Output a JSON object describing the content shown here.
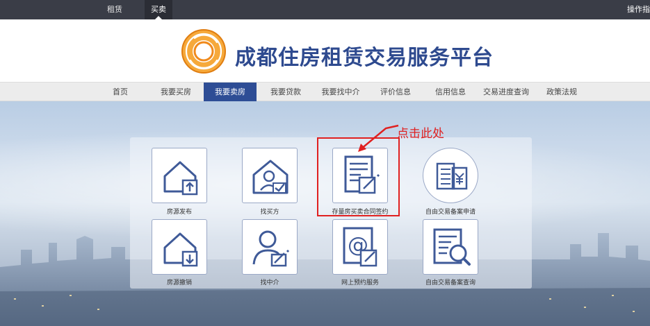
{
  "topbar": {
    "tabs": [
      {
        "label": "租赁"
      },
      {
        "label": "买卖"
      }
    ],
    "guide_label": "操作指"
  },
  "header": {
    "title": "成都住房租赁交易服务平台"
  },
  "nav": {
    "items": [
      {
        "label": "首页"
      },
      {
        "label": "我要买房"
      },
      {
        "label": "我要卖房"
      },
      {
        "label": "我要贷款"
      },
      {
        "label": "我要找中介"
      },
      {
        "label": "评价信息"
      },
      {
        "label": "信用信息"
      },
      {
        "label": "交易进度查询"
      },
      {
        "label": "政策法规"
      }
    ],
    "active_index": 2
  },
  "services": [
    {
      "label": "房源发布",
      "icon": "house-upload-icon"
    },
    {
      "label": "找买方",
      "icon": "find-buyer-icon"
    },
    {
      "label": "存量房买卖合同签约",
      "icon": "contract-sign-icon"
    },
    {
      "label": "自由交易备案申请",
      "icon": "record-apply-icon"
    },
    {
      "label": "房源撤销",
      "icon": "house-download-icon"
    },
    {
      "label": "找中介",
      "icon": "find-agent-icon"
    },
    {
      "label": "网上预约服务",
      "icon": "online-booking-icon"
    },
    {
      "label": "自由交易备案查询",
      "icon": "record-query-icon"
    }
  ],
  "annotation": {
    "text": "点击此处"
  },
  "colors": {
    "topbar": "#3a3d47",
    "brand_blue": "#2e4a8f",
    "nav_active": "#2e4d95",
    "icon_blue": "#3f5a98",
    "annotation_red": "#e02020",
    "logo_orange": "#f08a1c"
  }
}
